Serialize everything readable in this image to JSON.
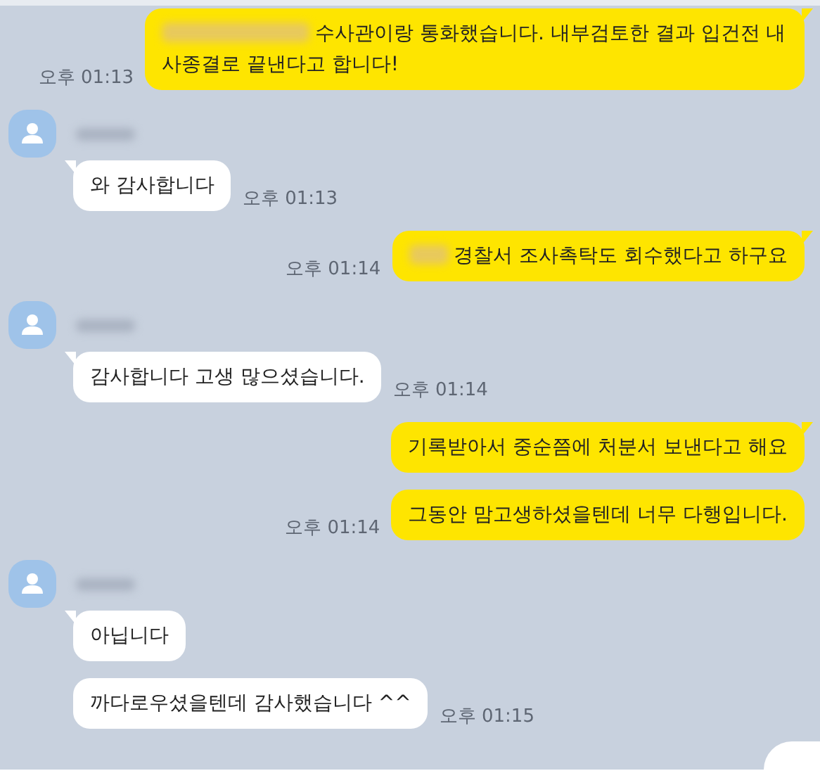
{
  "groups": [
    {
      "kind": "sent",
      "messages": [
        {
          "redacted_prefix": true,
          "text": "수사관이랑 통화했습니다. 내부검토한 결과 입건전 내사종결로 끝낸다고 합니다!",
          "time": "오후 01:13"
        }
      ]
    },
    {
      "kind": "received",
      "messages": [
        {
          "redacted_prefix": false,
          "text": "와 감사합니다",
          "time": "오후 01:13"
        }
      ]
    },
    {
      "kind": "sent",
      "messages": [
        {
          "redacted_prefix": true,
          "text": "경찰서 조사촉탁도 회수했다고 하구요",
          "time": "오후 01:14"
        }
      ]
    },
    {
      "kind": "received",
      "messages": [
        {
          "redacted_prefix": false,
          "text": "감사합니다 고생 많으셨습니다.",
          "time": "오후 01:14"
        }
      ]
    },
    {
      "kind": "sent",
      "messages": [
        {
          "redacted_prefix": false,
          "text": "기록받아서 중순쯤에 처분서 보낸다고 해요"
        },
        {
          "redacted_prefix": false,
          "text": "그동안 맘고생하셨을텐데 너무 다행입니다.",
          "time": "오후 01:14"
        }
      ]
    },
    {
      "kind": "received",
      "messages": [
        {
          "redacted_prefix": false,
          "text": "아닙니다"
        },
        {
          "redacted_prefix": false,
          "text": "까다로우셨을텐데 감사했습니다 ^^",
          "time": "오후 01:15"
        }
      ]
    }
  ]
}
